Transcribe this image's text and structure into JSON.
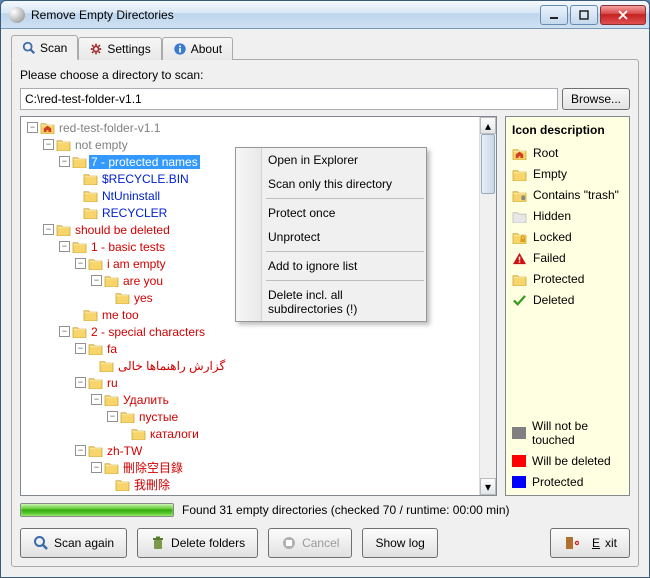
{
  "window": {
    "title": "Remove Empty Directories"
  },
  "tabs": {
    "scan": "Scan",
    "settings": "Settings",
    "about": "About"
  },
  "prompt": "Please choose a directory to scan:",
  "path": "C:\\red-test-folder-v1.1",
  "browse": "Browse...",
  "tree": {
    "root": "red-test-folder-v1.1",
    "not_empty": "not empty",
    "protected_names": "7 - protected names",
    "recycle_bin": "$RECYCLE.BIN",
    "ntuninstall": "NtUninstall",
    "recycler": "RECYCLER",
    "should_be_deleted": "should be deleted",
    "basic_tests": "1 - basic tests",
    "i_am_empty": "i am empty",
    "are_you": "are you",
    "yes": "yes",
    "me_too": "me too",
    "special_chars": "2 - special characters",
    "fa": "fa",
    "fa_text": "گزارش راهنماها خالی",
    "ru": "ru",
    "ru_del": "Удалить",
    "ru_empty": "пустые",
    "ru_catalogs": "каталоги",
    "zh": "zh-TW",
    "zh_1": "刪除空目錄",
    "zh_2": "我刪除"
  },
  "context_menu": {
    "open": "Open in Explorer",
    "scan_only": "Scan only this directory",
    "protect_once": "Protect once",
    "unprotect": "Unprotect",
    "add_ignore": "Add to ignore list",
    "delete_incl": "Delete incl. all subdirectories (!)"
  },
  "legend": {
    "title": "Icon description",
    "root": "Root",
    "empty": "Empty",
    "trash": "Contains \"trash\"",
    "hidden": "Hidden",
    "locked": "Locked",
    "failed": "Failed",
    "protected": "Protected",
    "deleted": "Deleted",
    "will_not": "Will not be touched",
    "will_del": "Will be deleted",
    "prot": "Protected"
  },
  "status": "Found 31 empty directories (checked 70 / runtime: 00:00 min)",
  "buttons": {
    "scan_again": "Scan again",
    "delete_folders": "Delete folders",
    "cancel": "Cancel",
    "show_log": "Show log",
    "exit": "Exit"
  }
}
